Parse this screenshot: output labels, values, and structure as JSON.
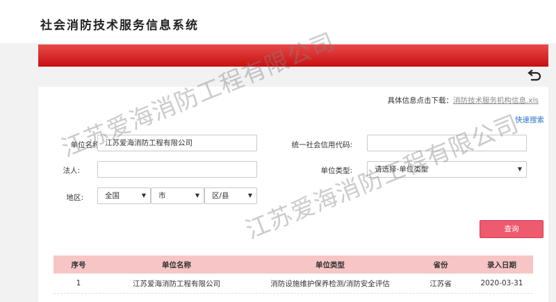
{
  "app": {
    "title": "社会消防技术服务信息系统"
  },
  "download": {
    "prefix": "具体信息点击下载：",
    "link_text": "消防技术服务机构信息.xls"
  },
  "quick_search": "快速搜索",
  "form": {
    "unit_name_label": "单位名称:",
    "unit_name_value": "江苏爱海消防工程有限公司",
    "credit_code_label": "统一社会信用代码:",
    "credit_code_value": "",
    "legal_person_label": "法人:",
    "legal_person_value": "",
    "unit_type_label": "单位类型:",
    "unit_type_selected": "请选择-单位类型",
    "region_label": "地区:",
    "province_selected": "全国",
    "city_selected": "市",
    "district_selected": "区/县",
    "query_button": "查询"
  },
  "table": {
    "headers": [
      "序号",
      "单位名称",
      "单位类型",
      "省份",
      "录入日期"
    ],
    "rows": [
      [
        "1",
        "江苏爱海消防工程有限公司",
        "消防设施维护保养检测/消防安全评估",
        "江苏省",
        "2020-03-31"
      ]
    ]
  },
  "watermark": "江苏爱海消防工程有限公司"
}
